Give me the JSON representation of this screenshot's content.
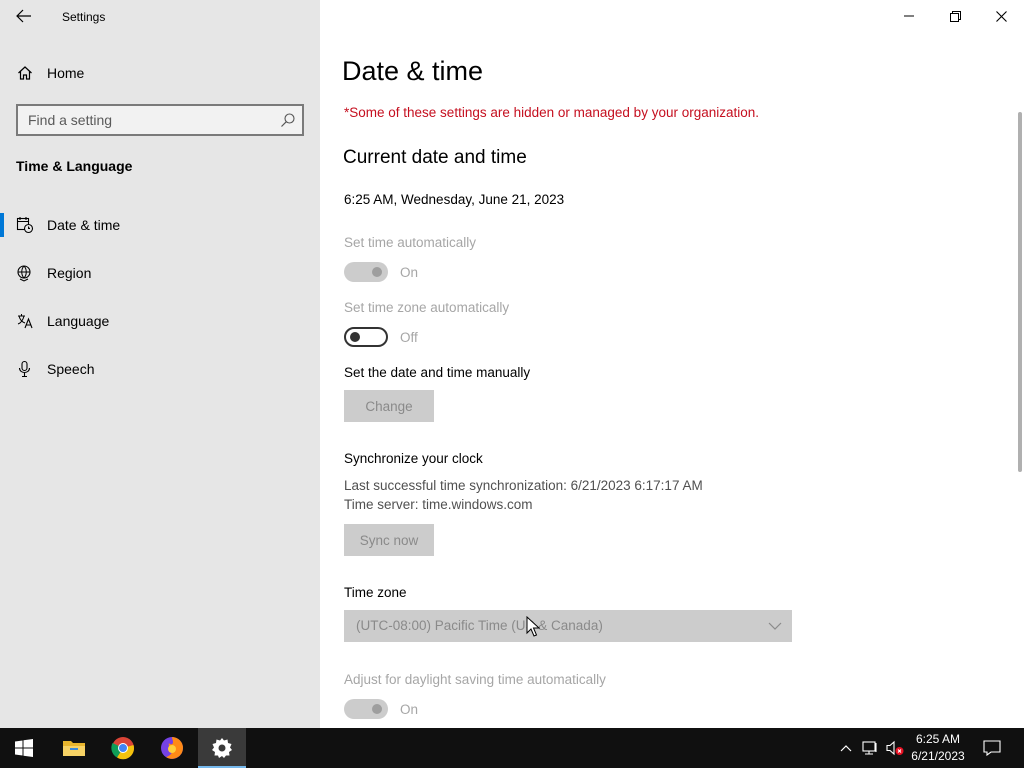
{
  "window": {
    "app_title": "Settings"
  },
  "sidebar": {
    "home_label": "Home",
    "search_placeholder": "Find a setting",
    "section_title": "Time & Language",
    "items": [
      {
        "label": "Date & time",
        "icon": "calendar-clock-icon",
        "selected": true
      },
      {
        "label": "Region",
        "icon": "globe-icon",
        "selected": false
      },
      {
        "label": "Language",
        "icon": "language-icon",
        "selected": false
      },
      {
        "label": "Speech",
        "icon": "microphone-icon",
        "selected": false
      }
    ]
  },
  "main": {
    "title": "Date & time",
    "org_note": "*Some of these settings are hidden or managed by your organization.",
    "current_heading": "Current date and time",
    "current_value": "6:25 AM, Wednesday, June 21, 2023",
    "set_time_auto": {
      "label": "Set time automatically",
      "state": "On"
    },
    "set_tz_auto": {
      "label": "Set time zone automatically",
      "state": "Off"
    },
    "manual": {
      "label": "Set the date and time manually",
      "button": "Change"
    },
    "sync": {
      "heading": "Synchronize your clock",
      "last_sync": "Last successful time synchronization: 6/21/2023 6:17:17 AM",
      "server": "Time server: time.windows.com",
      "button": "Sync now"
    },
    "timezone": {
      "label": "Time zone",
      "value": "(UTC-08:00) Pacific Time (US & Canada)"
    },
    "dst": {
      "label": "Adjust for daylight saving time automatically",
      "state": "On"
    }
  },
  "taskbar": {
    "clock_time": "6:25 AM",
    "clock_date": "6/21/2023"
  },
  "colors": {
    "accent": "#0078d7",
    "warning": "#c50f1f",
    "sidebar_bg": "#e6e6e6",
    "taskbar_bg": "#101010"
  }
}
